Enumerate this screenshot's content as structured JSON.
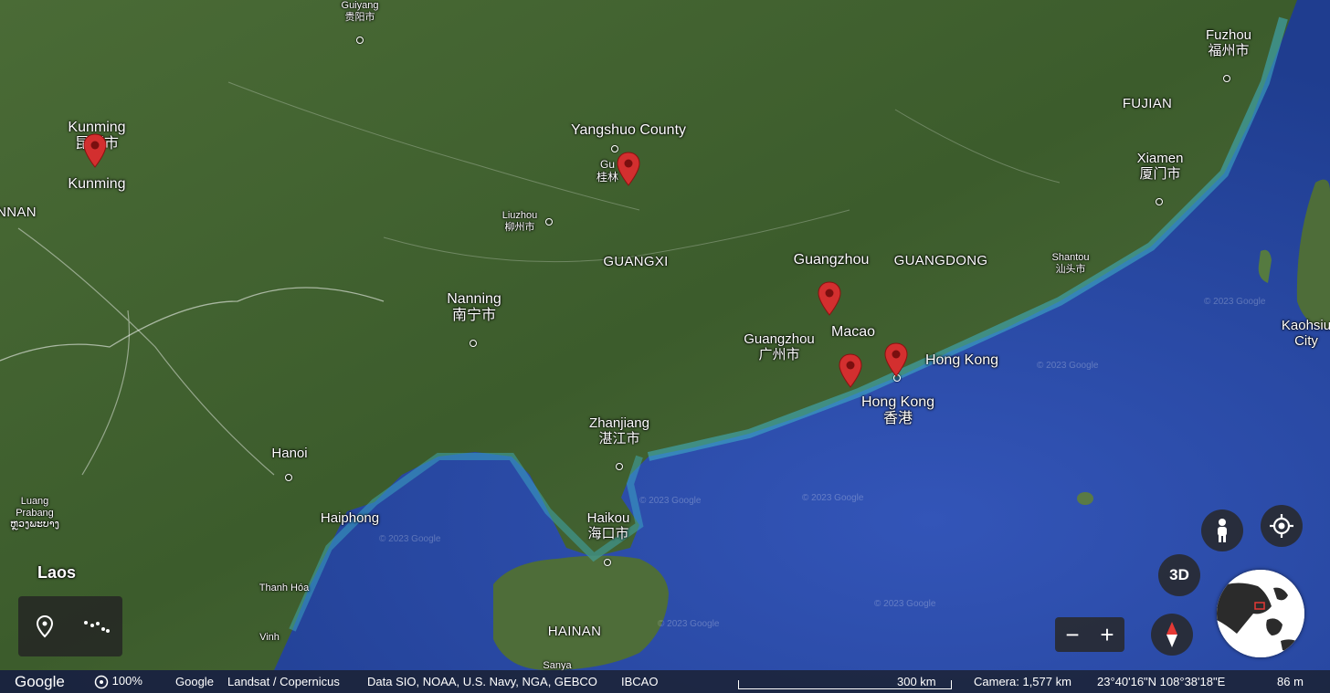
{
  "places": [
    {
      "name": "Guiyang",
      "zh": "贵阳市",
      "cls": "xs"
    },
    {
      "name": "Kunming",
      "zh": "昆明市",
      "cls": "big"
    },
    {
      "name": "Kunming",
      "zh": "",
      "cls": "big"
    },
    {
      "name": "NNAN",
      "zh": "",
      "cls": "region"
    },
    {
      "name": "Yangshuo County",
      "zh": "",
      "cls": "big"
    },
    {
      "name": "Gu",
      "zh": "桂林",
      "cls": "sm"
    },
    {
      "name": "Liuzhou",
      "zh": "柳州市",
      "cls": "xs"
    },
    {
      "name": "GUANGXI",
      "zh": "",
      "cls": "region"
    },
    {
      "name": "Guangzhou",
      "zh": "",
      "cls": "big"
    },
    {
      "name": "GUANGDONG",
      "zh": "",
      "cls": "region"
    },
    {
      "name": "Nanning",
      "zh": "南宁市",
      "cls": "big"
    },
    {
      "name": "Macao",
      "zh": "",
      "cls": "big"
    },
    {
      "name": "Guangzhou",
      "zh": "广州市",
      "cls": "med"
    },
    {
      "name": "Hong Kong",
      "zh": "",
      "cls": "big"
    },
    {
      "name": "Hong Kong",
      "zh": "香港",
      "cls": "big"
    },
    {
      "name": "Zhanjiang",
      "zh": "湛江市",
      "cls": "med"
    },
    {
      "name": "Hanoi",
      "zh": "",
      "cls": "med"
    },
    {
      "name": "Haiphong",
      "zh": "",
      "cls": "med"
    },
    {
      "name": "Haikou",
      "zh": "海口市",
      "cls": "med"
    },
    {
      "name": "Luang Prabang",
      "zh": "ຫຼວງພະບາງ",
      "cls": "xs"
    },
    {
      "name": "Laos",
      "zh": "",
      "cls": "country"
    },
    {
      "name": "Thanh Hóa",
      "zh": "",
      "cls": "xs"
    },
    {
      "name": "Vinh",
      "zh": "",
      "cls": "xs"
    },
    {
      "name": "HAINAN",
      "zh": "",
      "cls": "region"
    },
    {
      "name": "Sanya",
      "zh": "",
      "cls": "xs"
    },
    {
      "name": "Fuzhou",
      "zh": "福州市",
      "cls": "med"
    },
    {
      "name": "FUJIAN",
      "zh": "",
      "cls": "region"
    },
    {
      "name": "Xiamen",
      "zh": "厦门市",
      "cls": "med"
    },
    {
      "name": "Shantou",
      "zh": "汕头市",
      "cls": "xs"
    },
    {
      "name": "Kaohsiu",
      "zh": "City",
      "cls": "med"
    }
  ],
  "watermark": "© 2023 Google",
  "controls": {
    "btn_3d": "3D",
    "zoom_out": "−",
    "zoom_in": "+"
  },
  "status": {
    "brand": "Google",
    "zoom": "100%",
    "attribution_1": "Google",
    "attribution_2": "Landsat / Copernicus",
    "attribution_3": "Data SIO, NOAA, U.S. Navy, NGA, GEBCO",
    "attribution_4": "IBCAO",
    "scale": "300 km",
    "camera": "Camera: 1,577 km",
    "coords": "23°40'16\"N 108°38'18\"E",
    "elevation": "86 m"
  },
  "colors": {
    "pin": "#d32f2f",
    "sea": "#2b4fa8",
    "land": "#3f5f2f"
  },
  "icons": [
    "placemark-tool-icon",
    "path-tool-icon",
    "pegman-icon",
    "my-location-icon",
    "compass-icon",
    "globe-icon"
  ]
}
